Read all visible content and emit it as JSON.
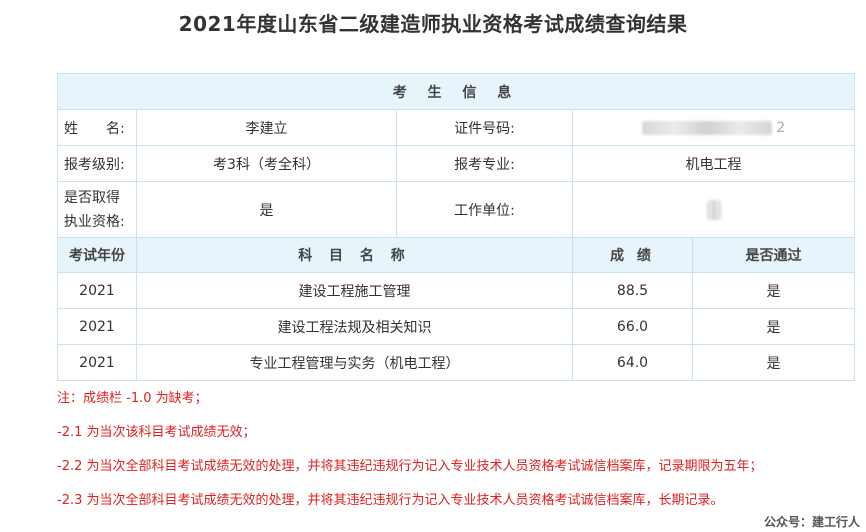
{
  "page_title": "2021年度山东省二级建造师执业资格考试成绩查询结果",
  "section_header": "考 生 信 息",
  "candidate": {
    "name_label": "姓　　名:",
    "name_value": "李建立",
    "id_label": "证件号码:",
    "id_value_visible": "2",
    "level_label": "报考级别:",
    "level_value": "考3科（考全科）",
    "major_label": "报考专业:",
    "major_value": "机电工程",
    "qualified_label": "是否取得执业资格:",
    "qualified_value": "是",
    "employer_label": "工作单位:"
  },
  "score_table": {
    "headers": [
      "考试年份",
      "科 目 名 称",
      "成 绩",
      "是否通过"
    ],
    "rows": [
      {
        "year": "2021",
        "subject": "建设工程施工管理",
        "score": "88.5",
        "passed": "是"
      },
      {
        "year": "2021",
        "subject": "建设工程法规及相关知识",
        "score": "66.0",
        "passed": "是"
      },
      {
        "year": "2021",
        "subject": "专业工程管理与实务（机电工程）",
        "score": "64.0",
        "passed": "是"
      }
    ]
  },
  "notes": [
    "注：成绩栏 -1.0 为缺考；",
    "-2.1 为当次该科目考试成绩无效；",
    "-2.2 为当次全部科目考试成绩无效的处理，并将其违纪违规行为记入专业技术人员资格考试诚信档案库，记录期限为五年；",
    "-2.3 为当次全部科目考试成绩无效的处理，并将其违纪违规行为记入专业技术人员资格考试诚信档案库，长期记录。"
  ],
  "watermark": "公众号：建工行人",
  "colors": {
    "border": "#c9e2f1",
    "header_bg": "#e7f4fb",
    "note_red": "#e02020"
  }
}
